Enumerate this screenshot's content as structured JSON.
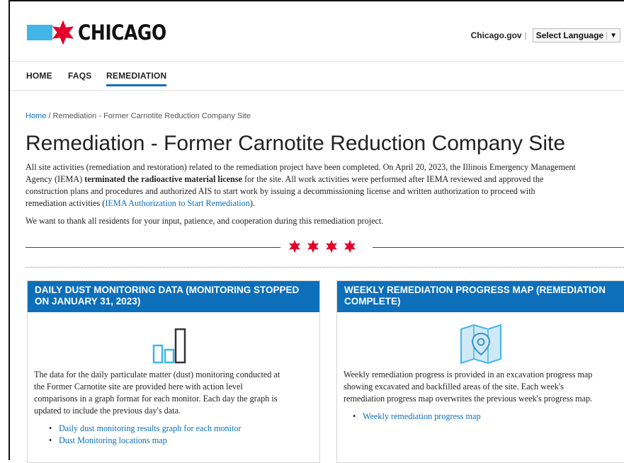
{
  "header": {
    "logo_text": "CHICAGO",
    "site_link": "Chicago.gov",
    "separator": "|",
    "language_label": "Select Language",
    "language_arrow": "▼"
  },
  "nav": {
    "items": [
      {
        "label": "HOME"
      },
      {
        "label": "FAQS"
      },
      {
        "label": "REMEDIATION"
      }
    ]
  },
  "breadcrumb": {
    "home": "Home",
    "separator": "/",
    "current": "Remediation - Former Carnotite Reduction Company Site"
  },
  "page": {
    "title": "Remediation - Former Carnotite Reduction Company Site",
    "intro": {
      "line1": "All site activities (remediation and restoration) related to the remediation project have been completed.  On April 20, 2023, the Illinois Emergency Management",
      "line2_before": "Agency (IEMA) ",
      "line2_bold": "terminated the radioactive material license",
      "line2_after": " for the site. All work activities were performed after IEMA  reviewed and approved the",
      "line3": "construction plans and procedures and authorized AIS to start work by issuing a decommissioning license and written authorization to proceed with",
      "line4_before": "remediation activities (",
      "line4_link": "IEMA Authorization to Start Remediation",
      "line4_after": ")."
    },
    "thanks": "We want to thank all residents for your input, patience, and cooperation during this remediation project."
  },
  "cards": {
    "left": {
      "title_line1": "DAILY DUST MONITORING DATA (MONITORING STOPPED",
      "title_line2": "ON JANUARY 31, 2023)",
      "icon": "bar-chart-icon",
      "text_line1": "The data for the daily particulate matter (dust) monitoring conducted at",
      "text_line2": "the Former Carnotite site are provided here with action level",
      "text_line3": "comparisons in a graph format for each monitor. Each day the graph is",
      "text_line4": "updated to include the previous day's data.",
      "links": [
        "Daily dust monitoring results graph for each monitor",
        "Dust Monitoring locations map"
      ]
    },
    "right": {
      "title_line1": "WEEKLY REMEDIATION PROGRESS MAP (REMEDIATION",
      "title_line2": "COMPLETE)",
      "icon": "map-pin-icon",
      "text_line1": "Weekly remediation progress is provided in an excavation progress map",
      "text_line2": "showing excavated and backfilled areas of the site. Each week's",
      "text_line3": "remediation progress map overwrites the previous week's progress map.",
      "links": [
        "Weekly remediation progress map"
      ]
    }
  },
  "colors": {
    "brand_blue": "#0d6fba",
    "star_red": "#e4002b",
    "logo_light_blue": "#41b6e6"
  }
}
